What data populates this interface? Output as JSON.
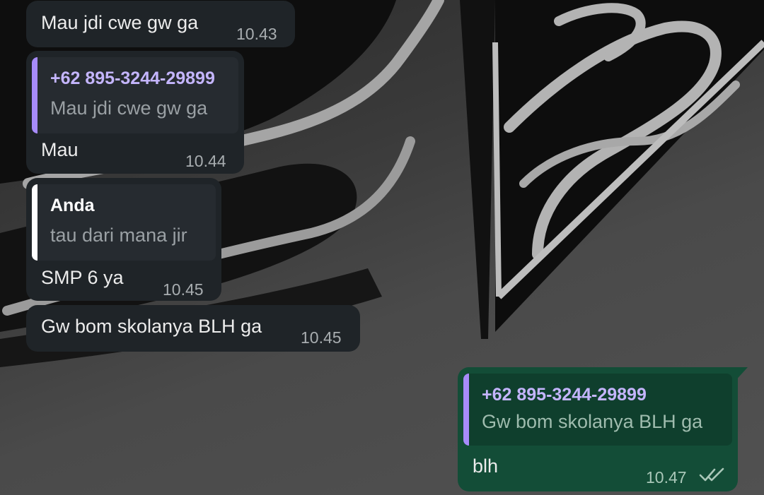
{
  "colors": {
    "incoming_bubble": "#1f2428",
    "outgoing_bubble": "#134d37",
    "quote_bar_contact": "#a78bfa",
    "quote_bar_self": "#ffffff",
    "quote_author_contact": "#c4b5fd",
    "quote_author_self": "#ffffff"
  },
  "messages": [
    {
      "direction": "incoming",
      "text": "Mau jdi cwe gw ga",
      "time": "10.43"
    },
    {
      "direction": "incoming",
      "quote": {
        "author": "+62 895-3244-29899",
        "text": "Mau jdi cwe gw ga"
      },
      "text": "Mau",
      "time": "10.44"
    },
    {
      "direction": "incoming",
      "quote": {
        "author": "Anda",
        "text": "tau dari mana jir"
      },
      "text": "SMP 6 ya",
      "time": "10.45"
    },
    {
      "direction": "incoming",
      "text": "Gw bom skolanya BLH ga",
      "time": "10.45"
    },
    {
      "direction": "outgoing",
      "quote": {
        "author": "+62 895-3244-29899",
        "text": "Gw bom skolanya BLH ga"
      },
      "text": "blh",
      "time": "10.47",
      "status_icon": "double-check-icon"
    }
  ]
}
